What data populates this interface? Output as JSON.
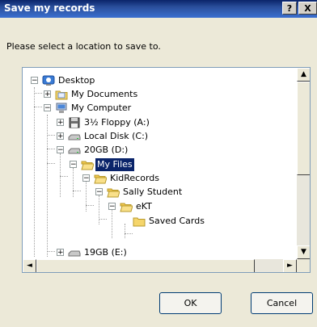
{
  "dialog": {
    "title": "Save my records",
    "help": "?",
    "close": "X",
    "instruction": "Please select a location to save to."
  },
  "tree": {
    "items": [
      {
        "label": "Desktop",
        "icon": "desktop-icon",
        "expander": "−"
      },
      {
        "label": "My Documents",
        "icon": "folder-documents-icon",
        "expander": "+"
      },
      {
        "label": "My Computer",
        "icon": "computer-icon",
        "expander": "−"
      },
      {
        "label": "3½ Floppy (A:)",
        "icon": "floppy-icon",
        "expander": "+"
      },
      {
        "label": "Local Disk (C:)",
        "icon": "drive-icon",
        "expander": "+"
      },
      {
        "label": "20GB (D:)",
        "icon": "drive-icon",
        "expander": "−"
      },
      {
        "label": "My Files",
        "icon": "folder-open-icon",
        "expander": "−",
        "selected": true
      },
      {
        "label": "KidRecords",
        "icon": "folder-open-icon",
        "expander": "−"
      },
      {
        "label": "Sally Student",
        "icon": "folder-open-icon",
        "expander": "−"
      },
      {
        "label": "eKT",
        "icon": "folder-open-icon",
        "expander": "−"
      },
      {
        "label": "Saved Cards",
        "icon": "folder-icon",
        "expander": ""
      },
      {
        "label": "19GB (E:)",
        "icon": "drive-icon",
        "expander": "+"
      }
    ]
  },
  "buttons": {
    "ok": "OK",
    "cancel": "Cancel"
  },
  "colors": {
    "titlebar": "#0a246a",
    "selection": "#0a246a",
    "window_bg": "#ECE9D8"
  }
}
